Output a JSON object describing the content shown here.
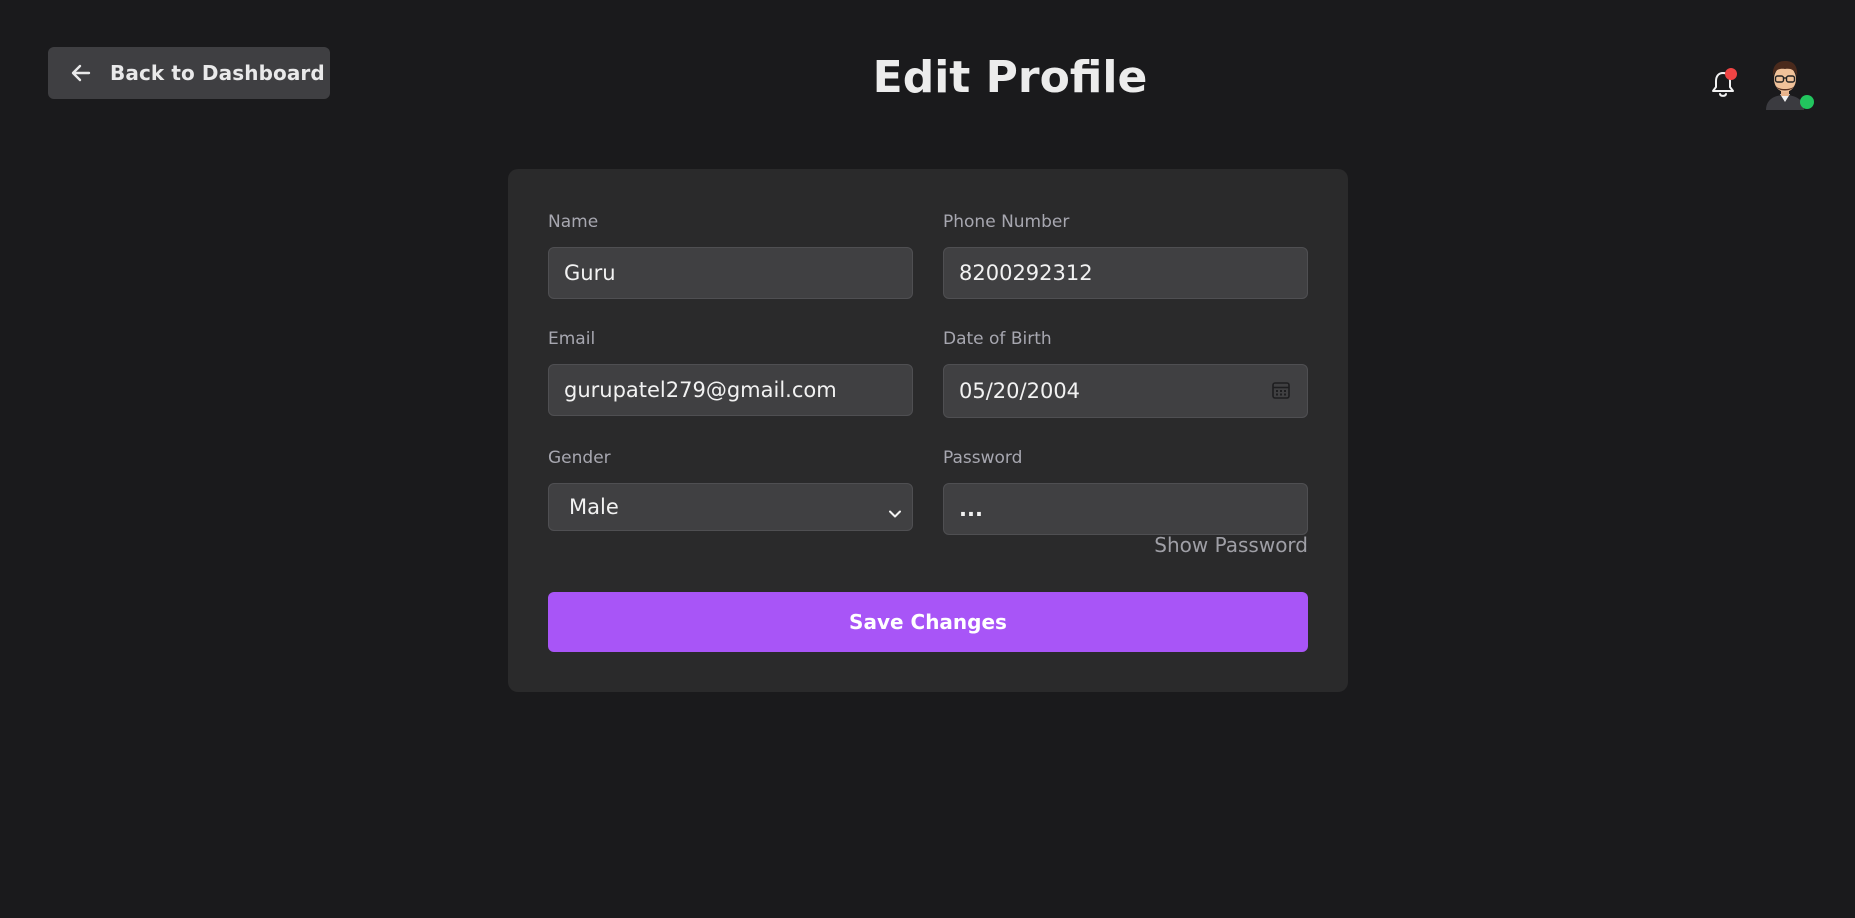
{
  "header": {
    "back_label": "Back to Dashboard",
    "title": "Edit Profile",
    "notification_icon": "bell-icon",
    "avatar_icon": "user-avatar-icon",
    "status_color": "#22c55e",
    "notification_dot_color": "#ef4444"
  },
  "form": {
    "name": {
      "label": "Name",
      "value": "Guru"
    },
    "phone": {
      "label": "Phone Number",
      "value": "8200292312"
    },
    "email": {
      "label": "Email",
      "value": "gurupatel279@gmail.com"
    },
    "dob": {
      "label": "Date of Birth",
      "value": "05/20/2004",
      "icon": "calendar-icon"
    },
    "gender": {
      "label": "Gender",
      "value": "Male",
      "icon": "chevron-down-icon"
    },
    "password": {
      "label": "Password",
      "value": "..."
    },
    "show_password_label": "Show Password",
    "save_label": "Save Changes"
  },
  "colors": {
    "background": "#1a1a1c",
    "card": "#2a2a2b",
    "accent": "#a855f7"
  }
}
